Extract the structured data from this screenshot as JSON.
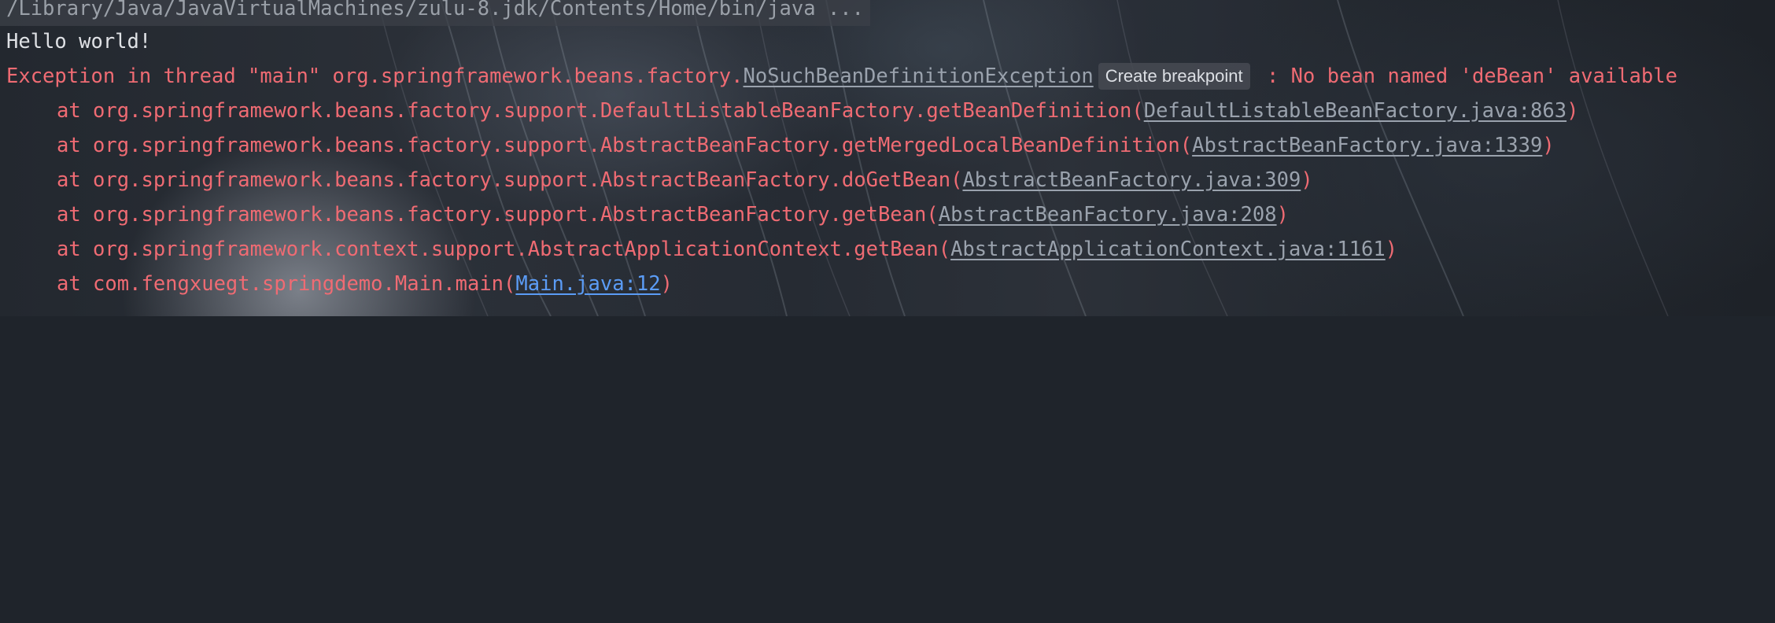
{
  "console": {
    "command": "/Library/Java/JavaVirtualMachines/zulu-8.jdk/Contents/Home/bin/java ...",
    "output": "Hello world!",
    "exception": {
      "prefix": "Exception in thread \"main\" org.springframework.beans.factory.",
      "class_link": "NoSuchBeanDefinitionException",
      "hint": "Create breakpoint",
      "message": " : No bean named 'deBean' available"
    },
    "stack": [
      {
        "prefix": "at org.springframework.beans.factory.support.DefaultListableBeanFactory.getBeanDefinition(",
        "link": "DefaultListableBeanFactory.java:863",
        "suffix": ")"
      },
      {
        "prefix": "at org.springframework.beans.factory.support.AbstractBeanFactory.getMergedLocalBeanDefinition(",
        "link": "AbstractBeanFactory.java:1339",
        "suffix": ")"
      },
      {
        "prefix": "at org.springframework.beans.factory.support.AbstractBeanFactory.doGetBean(",
        "link": "AbstractBeanFactory.java:309",
        "suffix": ")"
      },
      {
        "prefix": "at org.springframework.beans.factory.support.AbstractBeanFactory.getBean(",
        "link": "AbstractBeanFactory.java:208",
        "suffix": ")"
      },
      {
        "prefix": "at org.springframework.context.support.AbstractApplicationContext.getBean(",
        "link": "AbstractApplicationContext.java:1161",
        "suffix": ")"
      },
      {
        "prefix": "at com.fengxuegt.springdemo.Main.main(",
        "link": "Main.java:12",
        "suffix": ")"
      }
    ]
  },
  "colors": {
    "background": "#1f242b",
    "error_text": "#ef6b73",
    "library_link": "#9aa2ad",
    "user_link": "#5b9cf6",
    "plain_text": "#dfe1e5"
  }
}
